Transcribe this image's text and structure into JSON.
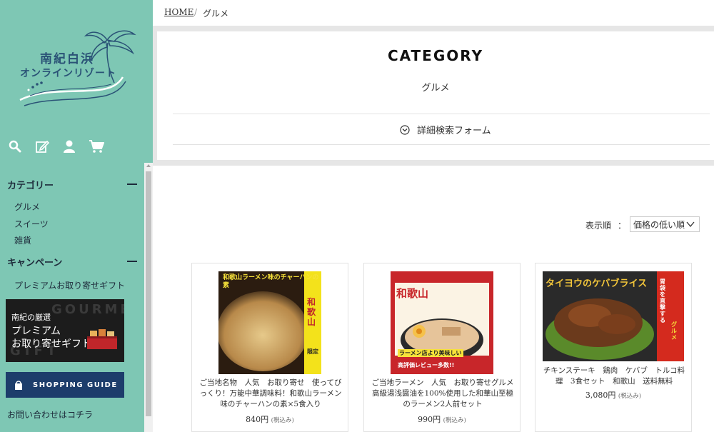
{
  "logo": {
    "line1": "南紀白浜",
    "line2": "オンラインリゾート"
  },
  "icons": [
    "search-icon",
    "edit-icon",
    "user-icon",
    "cart-icon"
  ],
  "sidebar": {
    "category_heading": "カテゴリー",
    "categories": [
      "グルメ",
      "スイーツ",
      "雑貨"
    ],
    "campaign_heading": "キャンペーン",
    "campaign_item": "プレミアムお取り寄せギフト",
    "banner": {
      "bg_text1": "GOURMET",
      "bg_text2": "GIFT",
      "line1": "南紀の厳選",
      "line2": "プレミアム",
      "line3": "お取り寄せギフト"
    },
    "guide_label": "SHOPPING GUIDE",
    "contact": "お問い合わせはコチラ"
  },
  "breadcrumb": {
    "home": "HOME",
    "sep": "/",
    "current": "グルメ"
  },
  "category": {
    "title": "CATEGORY",
    "name": "グルメ",
    "search_toggle": "詳細検索フォーム"
  },
  "sort": {
    "label": "表示順",
    "colon": "：",
    "selected": "価格の低い順"
  },
  "products": [
    {
      "desc": "ご当地名物　人気　お取り寄せ　使ってびっくり！万能中華調味料！和歌山ラーメン味のチャーハンの素×5食入り",
      "price": "840円",
      "tax": "(税込み)",
      "img_text": "和歌山",
      "img_banner": "和歌山ラーメン味のチャーハンの素",
      "img_tag": "限定"
    },
    {
      "desc": "ご当地ラーメン　人気　お取り寄せグルメ　高級湯浅醤油を100%使用した和華山至極のラーメン2人前セット",
      "price": "990円",
      "tax": "(税込み)",
      "img_text": "和歌山",
      "img_banner": "ラーメン店より美味しい",
      "img_tag": "高評価レビュー多数!!"
    },
    {
      "desc": "チキンステーキ　鶏肉　ケバブ　トルコ料理　3食セット　和歌山　送料無料",
      "price": "3,080円",
      "tax": "(税込み)",
      "img_text": "タイヨウのケバブライス",
      "img_banner": "胃袋を直撃する",
      "img_tag": "グルメ"
    }
  ]
}
